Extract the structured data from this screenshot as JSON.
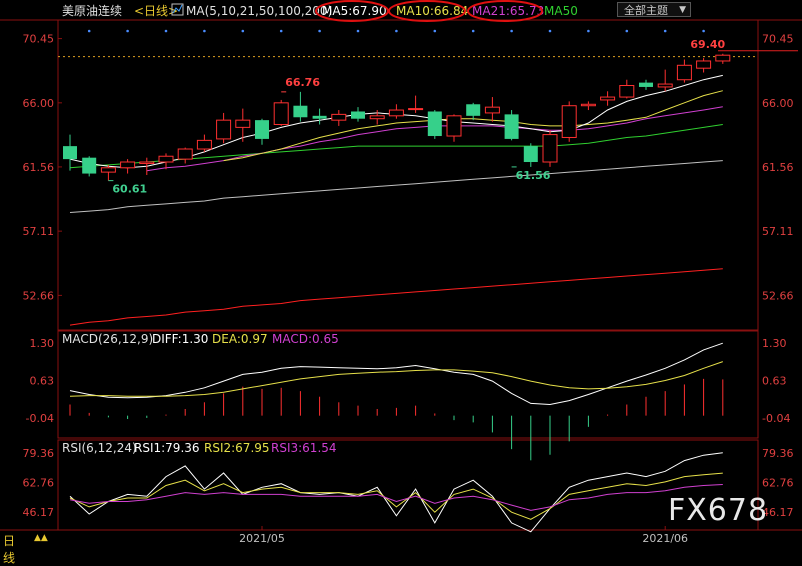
{
  "header": {
    "instrument": "美原油连续",
    "period": "<日线>",
    "ma_label": "MA(5,10,21,50,100,200)",
    "ma5": "MA5:67.90",
    "ma10": "MA10:66.84",
    "ma21": "MA21:65.73",
    "ma50": "MA50",
    "theme_button": "全部主题"
  },
  "macd_header": {
    "label": "MACD(26,12,9)",
    "diff": "DIFF:1.30",
    "dea": "DEA:0.97",
    "macd": "MACD:0.65"
  },
  "rsi_header": {
    "label": "RSI(6,12,24)",
    "rsi1": "RSI1:79.36",
    "rsi2": "RSI2:67.95",
    "rsi3": "RSI3:61.54"
  },
  "footer": {
    "period_label": "日线",
    "arrows": "▲▲",
    "watermark": "FX678"
  },
  "colors": {
    "up": "#ff3030",
    "down": "#36d08a",
    "ma5": "#ffffff",
    "ma10": "#e6e04a",
    "ma21": "#d040d0",
    "ma50": "#30d030",
    "ma100": "#c0c0c0",
    "ma200": "#ff2020",
    "diff": "#ffffff",
    "dea": "#e6e04a",
    "rsi1": "#ffffff",
    "rsi2": "#e6e04a",
    "rsi3": "#d040d0"
  },
  "chart_data": [
    {
      "type": "candlestick",
      "title": "美原油连续 <日线>",
      "price_ticks": [
        "70.45",
        "66.00",
        "61.56",
        "57.11",
        "52.66"
      ],
      "price_tick_values": [
        70.45,
        66.0,
        61.56,
        57.11,
        52.66
      ],
      "ylim": [
        50.4,
        71.6
      ],
      "x_ticks": [
        "2021/05",
        "2021/06"
      ],
      "x_tick_index": [
        10,
        31
      ],
      "last_price": "69.40",
      "last_price_value": 69.4,
      "annotations": [
        {
          "text": "66.76",
          "index": 11,
          "value": 66.76,
          "kind": "high"
        },
        {
          "text": "60.61",
          "index": 2,
          "value": 60.61,
          "kind": "low"
        },
        {
          "text": "61.56",
          "index": 23,
          "value": 61.56,
          "kind": "low"
        },
        {
          "text": "69.40",
          "index": 32,
          "value": 69.4,
          "kind": "high"
        }
      ],
      "candles": [
        {
          "o": 63.0,
          "h": 63.8,
          "l": 61.3,
          "c": 62.1
        },
        {
          "o": 62.2,
          "h": 62.3,
          "l": 60.9,
          "c": 61.1
        },
        {
          "o": 61.2,
          "h": 61.7,
          "l": 60.61,
          "c": 61.5
        },
        {
          "o": 61.5,
          "h": 62.1,
          "l": 61.1,
          "c": 61.9
        },
        {
          "o": 61.8,
          "h": 62.2,
          "l": 61.0,
          "c": 61.9
        },
        {
          "o": 61.9,
          "h": 62.5,
          "l": 61.4,
          "c": 62.3
        },
        {
          "o": 62.1,
          "h": 62.9,
          "l": 61.8,
          "c": 62.8
        },
        {
          "o": 62.8,
          "h": 63.8,
          "l": 62.6,
          "c": 63.4
        },
        {
          "o": 63.5,
          "h": 65.3,
          "l": 63.2,
          "c": 64.8
        },
        {
          "o": 64.3,
          "h": 65.6,
          "l": 63.3,
          "c": 64.8
        },
        {
          "o": 64.8,
          "h": 64.9,
          "l": 63.1,
          "c": 63.5
        },
        {
          "o": 64.5,
          "h": 66.2,
          "l": 64.4,
          "c": 66.0
        },
        {
          "o": 65.8,
          "h": 66.76,
          "l": 64.7,
          "c": 65.0
        },
        {
          "o": 65.1,
          "h": 65.6,
          "l": 64.5,
          "c": 64.9
        },
        {
          "o": 64.8,
          "h": 65.5,
          "l": 64.4,
          "c": 65.2
        },
        {
          "o": 65.4,
          "h": 65.7,
          "l": 64.7,
          "c": 64.9
        },
        {
          "o": 64.9,
          "h": 65.5,
          "l": 64.5,
          "c": 65.1
        },
        {
          "o": 65.1,
          "h": 65.9,
          "l": 64.9,
          "c": 65.5
        },
        {
          "o": 65.6,
          "h": 66.5,
          "l": 65.3,
          "c": 65.6
        },
        {
          "o": 65.4,
          "h": 65.5,
          "l": 63.5,
          "c": 63.7
        },
        {
          "o": 63.7,
          "h": 65.2,
          "l": 63.3,
          "c": 65.1
        },
        {
          "o": 65.9,
          "h": 66.0,
          "l": 64.8,
          "c": 65.1
        },
        {
          "o": 65.3,
          "h": 66.4,
          "l": 64.7,
          "c": 65.7
        },
        {
          "o": 65.2,
          "h": 65.5,
          "l": 63.4,
          "c": 63.5
        },
        {
          "o": 63.0,
          "h": 63.2,
          "l": 61.56,
          "c": 61.9
        },
        {
          "o": 61.9,
          "h": 64.1,
          "l": 61.56,
          "c": 63.8
        },
        {
          "o": 63.6,
          "h": 66.1,
          "l": 63.3,
          "c": 65.8
        },
        {
          "o": 65.8,
          "h": 66.1,
          "l": 65.5,
          "c": 65.9
        },
        {
          "o": 66.2,
          "h": 66.8,
          "l": 65.8,
          "c": 66.4
        },
        {
          "o": 66.4,
          "h": 67.6,
          "l": 66.3,
          "c": 67.2
        },
        {
          "o": 67.4,
          "h": 67.6,
          "l": 66.9,
          "c": 67.1
        },
        {
          "o": 67.1,
          "h": 68.3,
          "l": 66.8,
          "c": 67.3
        },
        {
          "o": 67.6,
          "h": 69.0,
          "l": 67.4,
          "c": 68.6
        },
        {
          "o": 68.4,
          "h": 69.1,
          "l": 68.1,
          "c": 68.9
        },
        {
          "o": 68.9,
          "h": 69.4,
          "l": 68.7,
          "c": 69.3
        }
      ],
      "ma": {
        "ma5": [
          62.1,
          61.8,
          61.6,
          61.5,
          61.6,
          61.9,
          62.2,
          62.6,
          63.1,
          63.6,
          63.9,
          64.3,
          64.6,
          64.8,
          65.0,
          65.2,
          65.3,
          65.2,
          65.1,
          64.9,
          64.7,
          64.6,
          64.5,
          64.4,
          64.2,
          64.0,
          64.1,
          64.6,
          65.5,
          66.1,
          66.5,
          66.8,
          67.2,
          67.6,
          67.9
        ],
        "ma10": [
          null,
          null,
          null,
          null,
          null,
          null,
          null,
          null,
          62.0,
          62.2,
          62.5,
          62.8,
          63.2,
          63.6,
          63.9,
          64.2,
          64.4,
          64.6,
          64.7,
          64.8,
          64.9,
          64.9,
          64.8,
          64.7,
          64.5,
          64.4,
          64.4,
          64.5,
          64.6,
          64.8,
          65.0,
          65.5,
          66.0,
          66.5,
          66.84
        ],
        "ma21": [
          null,
          null,
          null,
          null,
          61.3,
          61.5,
          61.6,
          61.8,
          62.0,
          62.3,
          62.5,
          62.8,
          63.0,
          63.3,
          63.5,
          63.8,
          64.0,
          64.2,
          64.3,
          64.4,
          64.4,
          64.4,
          64.4,
          64.3,
          64.2,
          64.1,
          64.1,
          64.2,
          64.4,
          64.6,
          64.9,
          65.1,
          65.3,
          65.5,
          65.73
        ],
        "ma50": [
          61.5,
          61.6,
          61.7,
          61.8,
          61.9,
          62.0,
          62.1,
          62.2,
          62.3,
          62.4,
          62.5,
          62.6,
          62.7,
          62.8,
          62.9,
          63.0,
          63.0,
          63.0,
          63.0,
          63.0,
          63.0,
          63.0,
          63.0,
          63.0,
          63.0,
          63.0,
          63.1,
          63.2,
          63.4,
          63.6,
          63.7,
          63.9,
          64.1,
          64.3,
          64.5
        ],
        "ma100": [
          58.4,
          58.5,
          58.6,
          58.8,
          58.9,
          59.0,
          59.1,
          59.2,
          59.4,
          59.5,
          59.6,
          59.7,
          59.8,
          59.9,
          60.0,
          60.1,
          60.2,
          60.3,
          60.4,
          60.5,
          60.6,
          60.7,
          60.8,
          60.9,
          61.0,
          61.1,
          61.2,
          61.3,
          61.4,
          61.5,
          61.6,
          61.7,
          61.8,
          61.9,
          62.0
        ],
        "ma200": [
          50.6,
          50.8,
          50.9,
          51.1,
          51.2,
          51.3,
          51.5,
          51.6,
          51.7,
          51.9,
          52.0,
          52.1,
          52.3,
          52.4,
          52.5,
          52.6,
          52.7,
          52.8,
          52.9,
          53.0,
          53.1,
          53.2,
          53.3,
          53.4,
          53.5,
          53.6,
          53.7,
          53.8,
          53.9,
          54.0,
          54.1,
          54.2,
          54.3,
          54.4,
          54.5
        ]
      }
    },
    {
      "type": "line",
      "title": "MACD(26,12,9)",
      "ticks": [
        "1.30",
        "0.63",
        "-0.04"
      ],
      "tick_values": [
        1.3,
        0.63,
        -0.04
      ],
      "ylim": [
        -0.4,
        1.5
      ],
      "series": [
        {
          "name": "DIFF",
          "values": [
            0.45,
            0.38,
            0.33,
            0.32,
            0.33,
            0.36,
            0.42,
            0.5,
            0.62,
            0.74,
            0.78,
            0.85,
            0.88,
            0.87,
            0.86,
            0.85,
            0.84,
            0.86,
            0.9,
            0.84,
            0.78,
            0.74,
            0.62,
            0.4,
            0.22,
            0.2,
            0.27,
            0.38,
            0.5,
            0.62,
            0.73,
            0.85,
            1.0,
            1.18,
            1.3
          ]
        },
        {
          "name": "DEA",
          "values": [
            0.35,
            0.36,
            0.36,
            0.35,
            0.35,
            0.35,
            0.36,
            0.38,
            0.42,
            0.48,
            0.54,
            0.6,
            0.66,
            0.7,
            0.74,
            0.76,
            0.78,
            0.79,
            0.81,
            0.82,
            0.82,
            0.8,
            0.77,
            0.7,
            0.62,
            0.55,
            0.5,
            0.48,
            0.49,
            0.52,
            0.56,
            0.63,
            0.72,
            0.85,
            0.97
          ]
        }
      ],
      "histogram": {
        "name": "MACD",
        "values": [
          0.2,
          0.05,
          -0.03,
          -0.06,
          -0.04,
          0.02,
          0.12,
          0.24,
          0.4,
          0.52,
          0.48,
          0.5,
          0.44,
          0.34,
          0.24,
          0.18,
          0.12,
          0.14,
          0.18,
          0.04,
          -0.08,
          -0.12,
          -0.3,
          -0.6,
          -0.8,
          -0.7,
          -0.46,
          -0.2,
          0.02,
          0.2,
          0.34,
          0.44,
          0.56,
          0.66,
          0.65
        ]
      }
    },
    {
      "type": "line",
      "title": "RSI(6,12,24)",
      "ticks": [
        "79.36",
        "62.76",
        "46.17"
      ],
      "tick_values": [
        79.36,
        62.76,
        46.17
      ],
      "ylim": [
        36,
        86
      ],
      "series": [
        {
          "name": "RSI1",
          "values": [
            55,
            45,
            52,
            56,
            55,
            66,
            72,
            59,
            68,
            56,
            60,
            62,
            57,
            56,
            57,
            55,
            60,
            44,
            59,
            40,
            59,
            64,
            55,
            40,
            35,
            48,
            60,
            64,
            66,
            68,
            66,
            69,
            75,
            78,
            79.36
          ]
        },
        {
          "name": "RSI2",
          "values": [
            54,
            49,
            52,
            54,
            54,
            61,
            64,
            58,
            62,
            57,
            59,
            60,
            57,
            57,
            57,
            56,
            58,
            49,
            57,
            46,
            56,
            59,
            54,
            46,
            42,
            48,
            56,
            58,
            60,
            62,
            61,
            63,
            66,
            67,
            67.95
          ]
        },
        {
          "name": "RSI3",
          "values": [
            53,
            51,
            52,
            52,
            53,
            55,
            57,
            56,
            57,
            56,
            56,
            56,
            55,
            55,
            55,
            55,
            56,
            52,
            55,
            51,
            54,
            55,
            53,
            50,
            47,
            49,
            53,
            54,
            56,
            57,
            57,
            58,
            60,
            61,
            61.54
          ]
        }
      ]
    }
  ]
}
